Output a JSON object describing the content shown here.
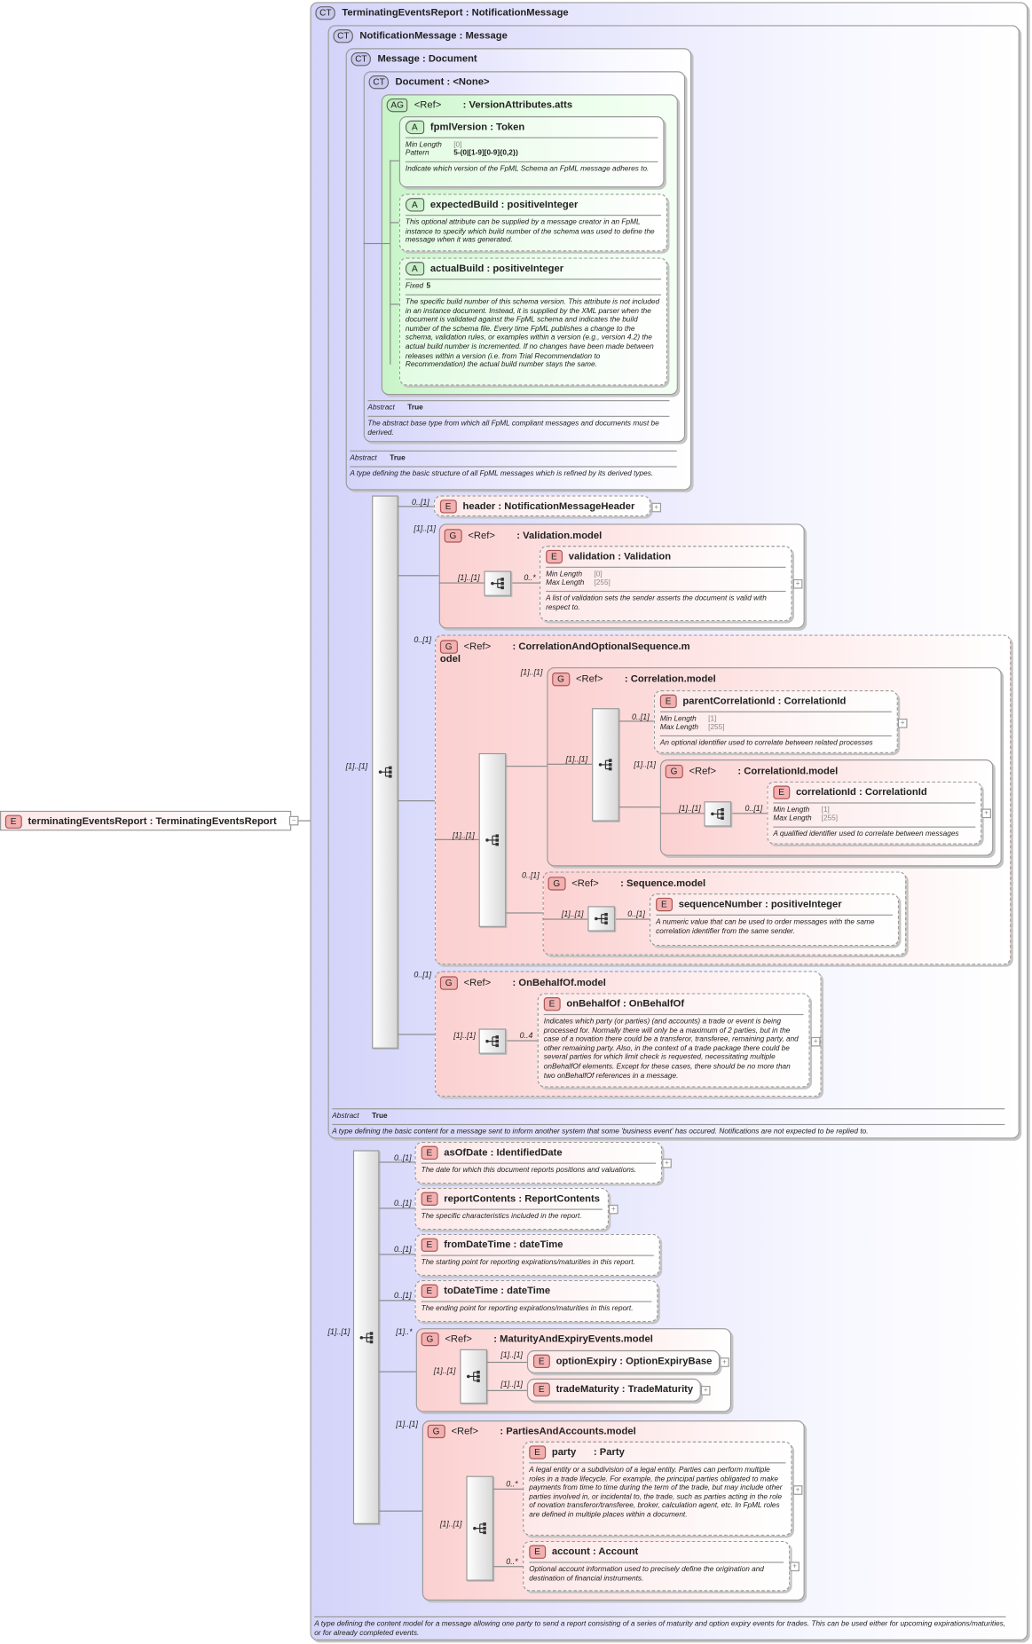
{
  "root": {
    "badge": "E",
    "name": "terminatingEventsReport",
    "type": "TerminatingEventsReport"
  },
  "ct_terminating": {
    "badge": "CT",
    "name": "TerminatingEventsReport",
    "type": "NotificationMessage",
    "description": "A type defining the content model for a message allowing one party to send a report consisting of a series of maturity and option expiry events for trades. This can be used either for upcoming expirations/maturities, or for already completed events."
  },
  "ct_notification": {
    "badge": "CT",
    "name": "NotificationMessage",
    "type": "Message",
    "abstract_label": "Abstract",
    "abstract_value": "True",
    "description": "A type defining the basic content for a message sent to inform another system that some 'business event' has occured. Notifications are not expected to be replied to."
  },
  "ct_message": {
    "badge": "CT",
    "name": "Message",
    "type": "Document",
    "abstract_label": "Abstract",
    "abstract_value": "True",
    "description": "A type defining the basic structure of all FpML messages which is refined by its derived types."
  },
  "ct_document": {
    "badge": "CT",
    "name": "Document",
    "type": "<None>",
    "abstract_label": "Abstract",
    "abstract_value": "True",
    "description": "The abstract base type from which all FpML compliant messages and documents must be derived."
  },
  "ag_version": {
    "badge": "AG",
    "ref": "<Ref>",
    "type": "VersionAttributes.atts"
  },
  "attr_fpml": {
    "badge": "A",
    "name": "fpmlVersion",
    "type": "Token",
    "facets": [
      {
        "k": "Min Length",
        "v": "[0]"
      },
      {
        "k": "Pattern",
        "v": "5-(0|[1-9][0-9]{0,2})"
      }
    ],
    "description": "Indicate which version of the FpML Schema an FpML message adheres to."
  },
  "attr_expected": {
    "badge": "A",
    "name": "expectedBuild",
    "type": "positiveInteger",
    "description": "This optional attribute can be supplied by a message creator in an FpML instance to specify which build number of the schema was used to define the message when it was generated."
  },
  "attr_actual": {
    "badge": "A",
    "name": "actualBuild",
    "type": "positiveInteger",
    "facets": [
      {
        "k": "Fixed",
        "v": "5"
      }
    ],
    "description": "The specific build number of this schema version. This attribute is not included in an instance document. Instead, it is supplied by the XML parser when the document is validated against the FpML schema and indicates the build number of the schema file. Every time FpML publishes a change to the schema, validation rules, or examples within a version (e.g., version 4.2) the actual build number is incremented. If no changes have been made between releases within a version (i.e. from Trial Recommendation to Recommendation) the actual build number stays the same."
  },
  "el_header": {
    "badge": "E",
    "name": "header",
    "type": "NotificationMessageHeader",
    "card": "0..[1]"
  },
  "g_validation": {
    "badge": "G",
    "ref": "<Ref>",
    "type": "Validation.model",
    "card": "[1]..[1]",
    "seq_card": "[1]..[1]"
  },
  "el_validation": {
    "badge": "E",
    "name": "validation",
    "type": "Validation",
    "card": "0..*",
    "facets": [
      {
        "k": "Min Length",
        "v": "[0]"
      },
      {
        "k": "Max Length",
        "v": "[255]"
      }
    ],
    "description": "A list of validation sets the sender asserts the document is valid with respect to."
  },
  "g_corrseq": {
    "badge": "G",
    "ref": "<Ref>",
    "type": "CorrelationAndOptionalSequence.m odel",
    "card": "0..[1]",
    "seq_card": "[1]..[1]"
  },
  "g_correlation": {
    "badge": "G",
    "ref": "<Ref>",
    "type": "Correlation.model",
    "card": "[1]..[1]",
    "seq_card": "[1]..[1]"
  },
  "el_parentcorr": {
    "badge": "E",
    "name": "parentCorrelationId",
    "type": "CorrelationId",
    "card": "0..[1]",
    "facets": [
      {
        "k": "Min Length",
        "v": "[1]"
      },
      {
        "k": "Max Length",
        "v": "[255]"
      }
    ],
    "description": "An optional identifier used to correlate between related processes"
  },
  "g_corrid": {
    "badge": "G",
    "ref": "<Ref>",
    "type": "CorrelationId.model",
    "card": "[1]..[1]",
    "seq_card": "[1]..[1]"
  },
  "el_corrid": {
    "badge": "E",
    "name": "correlationId",
    "type": "CorrelationId",
    "card": "0..[1]",
    "facets": [
      {
        "k": "Min Length",
        "v": "[1]"
      },
      {
        "k": "Max Length",
        "v": "[255]"
      }
    ],
    "description": "A qualified identifier used to correlate between messages"
  },
  "g_sequence": {
    "badge": "G",
    "ref": "<Ref>",
    "type": "Sequence.model",
    "card": "0..[1]",
    "seq_card": "[1]..[1]"
  },
  "el_seqnum": {
    "badge": "E",
    "name": "sequenceNumber",
    "type": "positiveInteger",
    "card": "0..[1]",
    "description": "A numeric value that can be used to order messages with the same correlation identifier from the same sender."
  },
  "g_onbehalf": {
    "badge": "G",
    "ref": "<Ref>",
    "type": "OnBehalfOf.model",
    "card": "0..[1]",
    "seq_card": "[1]..[1]"
  },
  "el_onbehalf": {
    "badge": "E",
    "name": "onBehalfOf",
    "type": "OnBehalfOf",
    "card": "0..4",
    "description": "Indicates which party (or parties) (and accounts) a trade or event is being processed for. Normally there will only be a maximum of 2 parties, but in the case of a novation there could be a transferor, transferee, remaining party, and other remaining party. Also, in the context of a trade package there could be several parties for which limit check is requested, necessitating multiple onBehalfOf elements. Except for these cases, there should be no more than two onBehalfOf references in a message."
  },
  "seq1_card": "[1]..[1]",
  "seq2_card": "[1]..[1]",
  "el_asofdate": {
    "badge": "E",
    "name": "asOfDate",
    "type": "IdentifiedDate",
    "card": "0..[1]",
    "description": "The date for which this document reports positions and valuations."
  },
  "el_reportcontents": {
    "badge": "E",
    "name": "reportContents",
    "type": "ReportContents",
    "card": "0..[1]",
    "description": "The specific characteristics included in the report."
  },
  "el_fromdt": {
    "badge": "E",
    "name": "fromDateTime",
    "type": "dateTime",
    "card": "0..[1]",
    "description": "The starting point for reporting expirations/maturities in this report."
  },
  "el_todt": {
    "badge": "E",
    "name": "toDateTime",
    "type": "dateTime",
    "card": "0..[1]",
    "description": "The ending point for reporting expirations/maturities in this report."
  },
  "g_maturity": {
    "badge": "G",
    "ref": "<Ref>",
    "type": "MaturityAndExpiryEvents.model",
    "card": "[1]..*",
    "seq_card": "[1]..[1]"
  },
  "el_optexp": {
    "badge": "E",
    "name": "optionExpiry",
    "type": "OptionExpiryBase",
    "card": "[1]..[1]"
  },
  "el_trademat": {
    "badge": "E",
    "name": "tradeMaturity",
    "type": "TradeMaturity",
    "card": "[1]..[1]"
  },
  "g_parties": {
    "badge": "G",
    "ref": "<Ref>",
    "type": "PartiesAndAccounts.model",
    "card": "[1]..[1]",
    "seq_card": "[1]..[1]"
  },
  "el_party": {
    "badge": "E",
    "name": "party",
    "type": "Party",
    "card": "0..*",
    "description": "A legal entity or a subdivision of a legal entity. Parties can perform multiple roles in a trade lifecycle. For example, the principal parties obligated to make payments from time to time during the term of the trade, but may include other parties involved in, or incidental to, the trade, such as parties acting in the role of novation transferor/transferee, broker, calculation agent, etc. In FpML roles are defined in multiple places within a document."
  },
  "el_account": {
    "badge": "E",
    "name": "account",
    "type": "Account",
    "card": "0..*",
    "description": "Optional account information used to precisely define the origination and destination of financial instruments."
  },
  "expand_symbol": "+",
  "collapse_symbol": "−"
}
